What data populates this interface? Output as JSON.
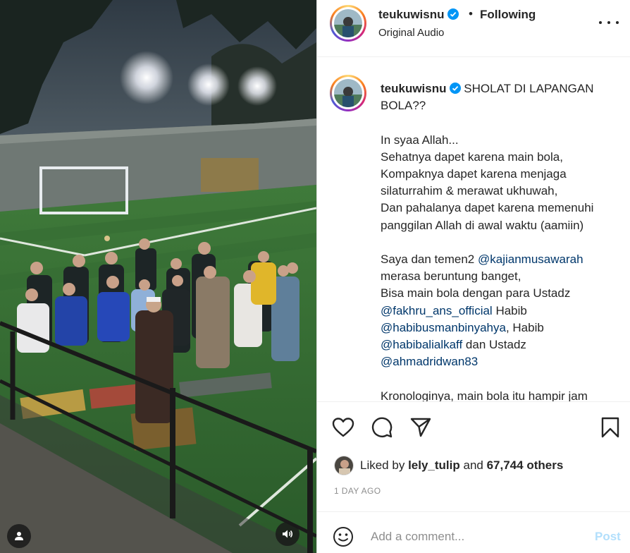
{
  "post": {
    "username": "teukuwisnu",
    "separator": "•",
    "follow_status": "Following",
    "audio_label": "Original Audio"
  },
  "caption": {
    "username": "teukuwisnu",
    "title_line1": "SHOLAT DI LAPANGAN",
    "title_line2": "BOLA??",
    "para1": [
      "In syaa Allah...",
      "Sehatnya dapet karena main bola,",
      "Kompaknya dapet karena menjaga",
      "silaturrahim & merawat ukhuwah,",
      "Dan pahalanya dapet karena memenuhi",
      "panggilan Allah di awal waktu (aamiin)"
    ],
    "p2_text1": "Saya dan temen2",
    "mention1": "@kajianmusawarah",
    "p2_line2": "merasa beruntung banget,",
    "p2_line3": "Bisa main bola dengan para Ustadz",
    "mention2": "@fakhru_ans_official",
    "p2_habib1": "Habib",
    "mention3": "@habibusmanbinyahya",
    "p2_habib2": ", Habib",
    "mention4": "@habibalialkaff",
    "p2_dan": "dan Ustadz",
    "mention5": "@ahmadridwan83",
    "p3_line1": "Kronologinya, main bola itu hampir jam"
  },
  "likes": {
    "prefix": "Liked by",
    "user": "lely_tulip",
    "connector": "and",
    "count_text": "67,744 others"
  },
  "time_ago": "1 DAY AGO",
  "comment": {
    "placeholder": "Add a comment...",
    "post_label": "Post"
  },
  "icons": {
    "verified": "verified-badge-icon",
    "more": "more-options-icon",
    "like": "heart-icon",
    "comment": "comment-bubble-icon",
    "share": "paper-plane-icon",
    "save": "bookmark-icon",
    "emoji": "smiley-icon",
    "user_tag": "user-icon",
    "audio": "speaker-icon"
  },
  "colors": {
    "text": "#262626",
    "secondary": "#8e8e8e",
    "mention": "#00376b",
    "verified": "#0095f6",
    "post_disabled": "#b2dffc"
  }
}
